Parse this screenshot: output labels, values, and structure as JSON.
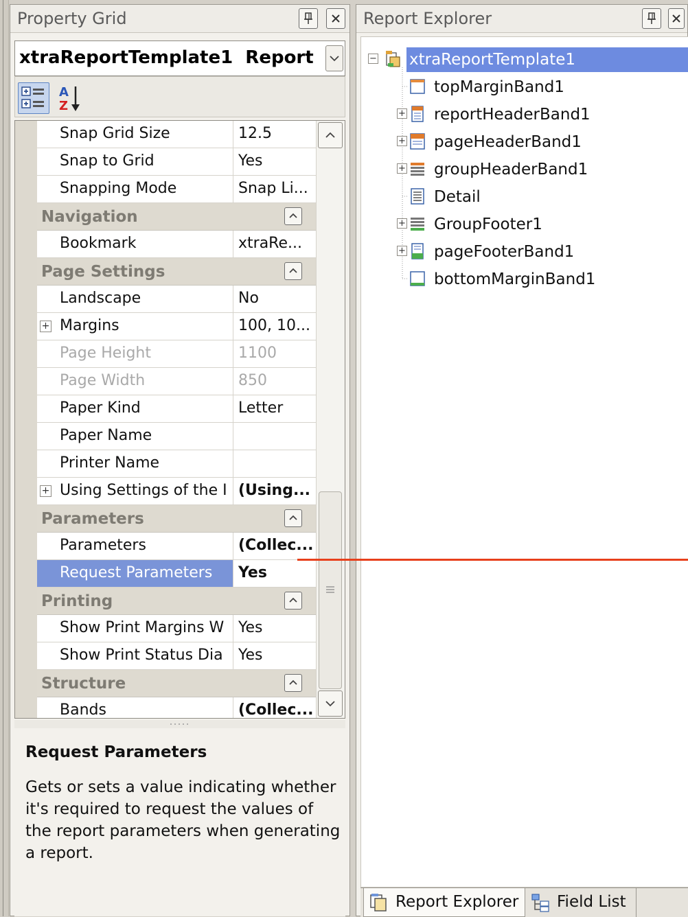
{
  "property_grid": {
    "title": "Property Grid",
    "object_name": "xtraReportTemplate1",
    "object_type": "Report",
    "rows": [
      {
        "kind": "prop",
        "name": "Snap Grid Size",
        "value": "12.5"
      },
      {
        "kind": "prop",
        "name": "Snap to Grid",
        "value": "Yes"
      },
      {
        "kind": "prop",
        "name": "Snapping Mode",
        "value": "Snap Li..."
      },
      {
        "kind": "cat",
        "name": "Navigation"
      },
      {
        "kind": "prop",
        "name": "Bookmark",
        "value": "xtraRe..."
      },
      {
        "kind": "cat",
        "name": "Page Settings"
      },
      {
        "kind": "prop",
        "name": "Landscape",
        "value": "No"
      },
      {
        "kind": "prop",
        "name": "Margins",
        "value": "100, 10...",
        "expandable": true
      },
      {
        "kind": "prop",
        "name": "Page Height",
        "value": "1100",
        "disabled": true
      },
      {
        "kind": "prop",
        "name": "Page Width",
        "value": "850",
        "disabled": true
      },
      {
        "kind": "prop",
        "name": "Paper Kind",
        "value": "Letter"
      },
      {
        "kind": "prop",
        "name": "Paper Name",
        "value": ""
      },
      {
        "kind": "prop",
        "name": "Printer Name",
        "value": ""
      },
      {
        "kind": "prop",
        "name": "Using Settings of the I",
        "value": "(Using...",
        "expandable": true,
        "bold": true
      },
      {
        "kind": "cat",
        "name": "Parameters"
      },
      {
        "kind": "prop",
        "name": "Parameters",
        "value": "(Collec...",
        "bold": true
      },
      {
        "kind": "prop",
        "name": "Request Parameters",
        "value": "Yes",
        "bold": true,
        "selected": true
      },
      {
        "kind": "cat",
        "name": "Printing"
      },
      {
        "kind": "prop",
        "name": "Show Print Margins W",
        "value": "Yes"
      },
      {
        "kind": "prop",
        "name": "Show Print Status Dia",
        "value": "Yes"
      },
      {
        "kind": "cat",
        "name": "Structure"
      },
      {
        "kind": "prop",
        "name": "Bands",
        "value": "(Collec...",
        "bold": true
      }
    ],
    "description": {
      "title": "Request Parameters",
      "body": "Gets or sets a value indicating whether it's required to request the values of the report parameters when generating a report."
    }
  },
  "report_explorer": {
    "title": "Report Explorer",
    "nodes": [
      {
        "label": "xtraReportTemplate1",
        "level": 0,
        "expander": "minus",
        "icon": "report-icon",
        "selected": true
      },
      {
        "label": "topMarginBand1",
        "level": 1,
        "expander": "none",
        "icon": "top-margin-band-icon"
      },
      {
        "label": "reportHeaderBand1",
        "level": 1,
        "expander": "plus",
        "icon": "report-header-band-icon"
      },
      {
        "label": "pageHeaderBand1",
        "level": 1,
        "expander": "plus",
        "icon": "page-header-band-icon"
      },
      {
        "label": "groupHeaderBand1",
        "level": 1,
        "expander": "plus",
        "icon": "group-header-band-icon"
      },
      {
        "label": "Detail",
        "level": 1,
        "expander": "none",
        "icon": "detail-band-icon"
      },
      {
        "label": "GroupFooter1",
        "level": 1,
        "expander": "plus",
        "icon": "group-footer-band-icon"
      },
      {
        "label": "pageFooterBand1",
        "level": 1,
        "expander": "plus",
        "icon": "page-footer-band-icon"
      },
      {
        "label": "bottomMarginBand1",
        "level": 1,
        "expander": "none",
        "icon": "bottom-margin-band-icon"
      }
    ],
    "tabs": [
      {
        "label": "Report Explorer",
        "active": true,
        "icon": "report-explorer-icon"
      },
      {
        "label": "Field List",
        "active": false,
        "icon": "field-list-icon"
      }
    ]
  },
  "colors": {
    "selection": "#7a94d8",
    "tree_selection": "#6d8be0",
    "annotation_arrow": "#e8401c"
  }
}
